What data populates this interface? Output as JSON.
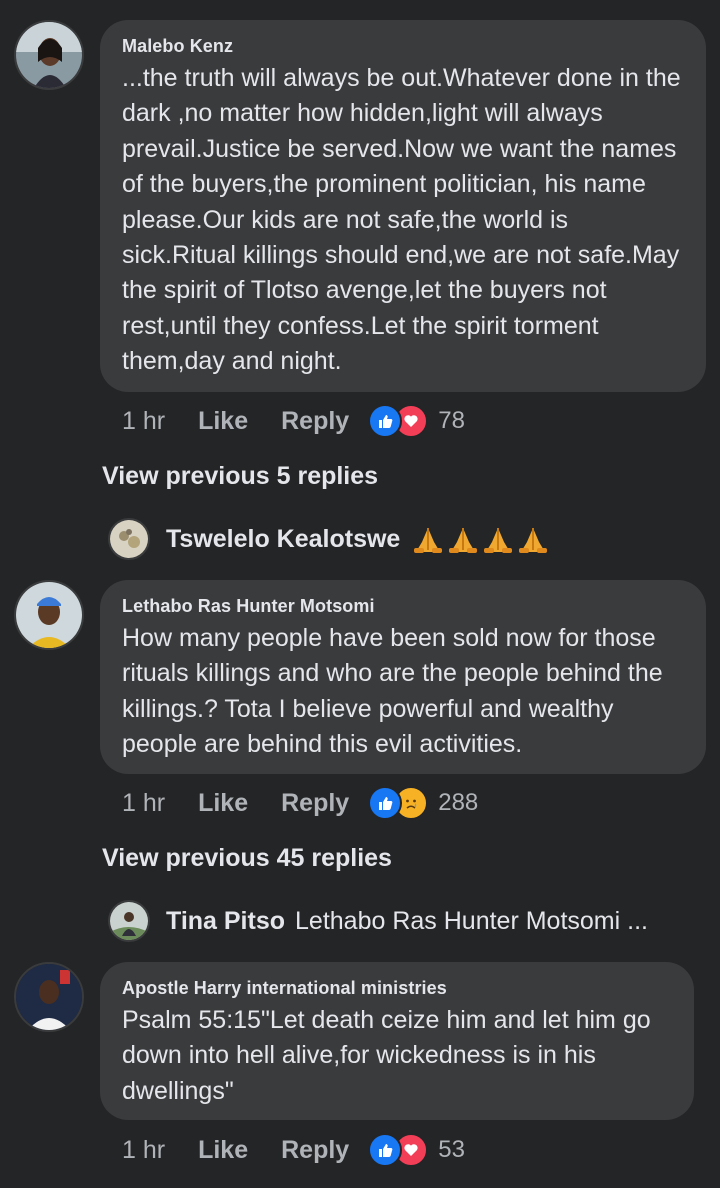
{
  "comments": [
    {
      "author": "Malebo Kenz",
      "text": "...the truth will always be out.Whatever done in the dark ,no matter how hidden,light will always prevail.Justice be served.Now we want the names of the buyers,the prominent politician, his name please.Our kids are not safe,the world is sick.Ritual killings should end,we are not safe.May the spirit of Tlotso avenge,let the buyers not rest,until they confess.Let the spirit torment them,day and night.",
      "time": "1 hr",
      "like_label": "Like",
      "reply_label": "Reply",
      "reaction_count": "78",
      "reactions": [
        "like",
        "love"
      ]
    },
    {
      "author": "Lethabo Ras Hunter Motsomi",
      "text": "How many people have been sold now for those rituals killings and who are the people behind the killings.? Tota I believe powerful and wealthy people are behind this evil activities.",
      "time": "1 hr",
      "like_label": "Like",
      "reply_label": "Reply",
      "reaction_count": "288",
      "reactions": [
        "like",
        "sad"
      ]
    },
    {
      "author": "Apostle Harry international ministries",
      "text": "Psalm 55:15\"Let death ceize him and let him go down into hell alive,for wickedness is in his dwellings\"",
      "time": "1 hr",
      "like_label": "Like",
      "reply_label": "Reply",
      "reaction_count": "53",
      "reactions": [
        "like",
        "love"
      ]
    }
  ],
  "view_previous": [
    "View previous 5 replies",
    "View previous 45 replies"
  ],
  "reply_previews": [
    {
      "name": "Tswelelo Kealotswe",
      "snippet": "",
      "emoji": [
        "folded-hands-emoji",
        "folded-hands-emoji",
        "folded-hands-emoji",
        "folded-hands-emoji"
      ]
    },
    {
      "name": "Tina Pitso",
      "snippet": "Lethabo Ras Hunter Motsomi ..."
    }
  ],
  "colors": {
    "background": "#242526",
    "bubble": "#3a3b3c",
    "text": "#e4e6eb",
    "muted": "#b0b3b8",
    "like_blue": "#1877f2",
    "love_red": "#f33e58",
    "sad_yellow": "#f7b125"
  }
}
